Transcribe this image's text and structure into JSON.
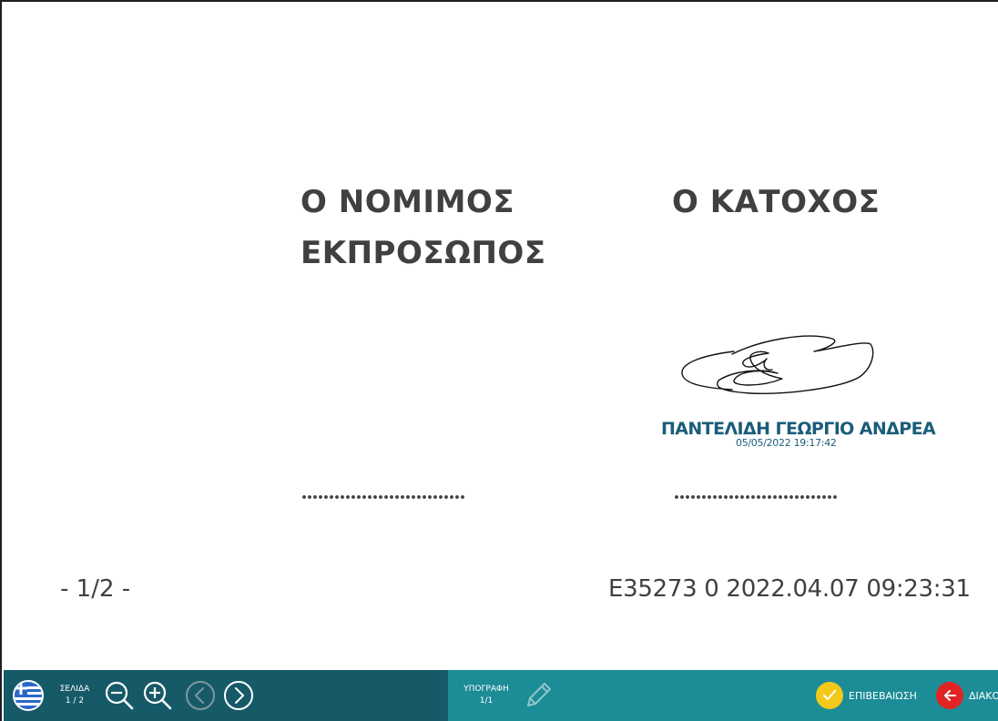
{
  "document": {
    "heading_left_line1": "Ο ΝΟΜΙΜΟΣ",
    "heading_left_line2": "ΕΚΠΡΟΣΩΠΟΣ",
    "heading_right": "Ο ΚΑΤΟΧΟΣ",
    "dots_left": "..............................",
    "dots_right": "..............................",
    "page_marker": "- 1/2 -",
    "document_ref": "E35273 0 2022.04.07 09:23:31",
    "signature": {
      "name": "ΠΑΝΤΕΛΙΔΗ ΓΕΩΡΓΙΟ ΑΝΔΡΕΑ",
      "timestamp": "05/05/2022 19:17:42",
      "color": "#1a5d7a"
    }
  },
  "toolbar": {
    "language_icon": "greek-flag-icon",
    "page_label": "ΣΕΛΙΔΑ",
    "page_value": "1 / 2",
    "zoom_out_icon": "zoom-out-icon",
    "zoom_in_icon": "zoom-in-icon",
    "prev_icon": "chevron-left-icon",
    "next_icon": "chevron-right-icon",
    "signature_label": "ΥΠΟΓΡΑΦΗ",
    "signature_value": "1/1",
    "signature_icon": "pen-icon",
    "confirm_label": "ΕΠΙΒΕΒΑΙΩΣΗ",
    "cancel_label": "ΔΙΑΚΟ",
    "colors": {
      "left_panel": "#165a68",
      "right_panel": "#1c8c97",
      "confirm": "#f2c81a",
      "cancel": "#e02424"
    }
  }
}
